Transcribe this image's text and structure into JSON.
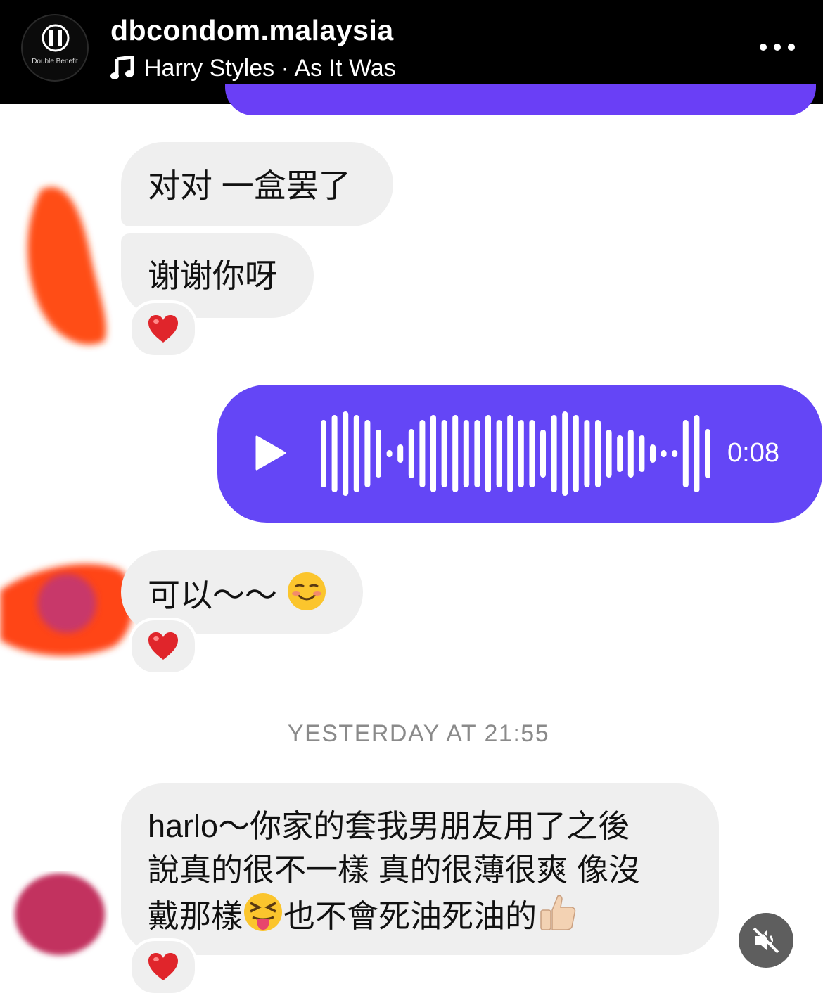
{
  "header": {
    "account_name": "dbcondom.malaysia",
    "logo_text": "Double Benefit",
    "music_label": "Harry Styles · As It Was",
    "icons": {
      "music": "music-note-icon",
      "more": "more-options-icon",
      "logo": "double-benefit-logo-icon"
    }
  },
  "messages": [
    {
      "direction": "incoming",
      "text": "对对 一盒罢了"
    },
    {
      "direction": "incoming",
      "text": "谢谢你呀",
      "reaction": "❤️"
    },
    {
      "direction": "outgoing",
      "type": "voice",
      "duration": "0:08"
    },
    {
      "direction": "incoming",
      "text": "可以～～",
      "emoji": "☺️",
      "reaction": "❤️"
    },
    {
      "direction": "incoming",
      "lines": [
        "harlo～你家的套我男朋友用了之後",
        "說真的很不一樣 真的很薄很爽 像沒",
        "戴那樣",
        "也不會死油死油的"
      ],
      "emojis": [
        "😝",
        "👍🏻"
      ],
      "reaction": "❤️"
    }
  ],
  "timestamp": "YESTERDAY AT 21:55",
  "colors": {
    "header_bg": "#000000",
    "voice_bubble": "#6446f6",
    "incoming_bubble": "#efefef",
    "timestamp": "#8a8a8a",
    "heart": "#e0252b"
  },
  "icons": {
    "play": "play-icon",
    "mute": "speaker-muted-icon",
    "heart": "heart-icon"
  }
}
